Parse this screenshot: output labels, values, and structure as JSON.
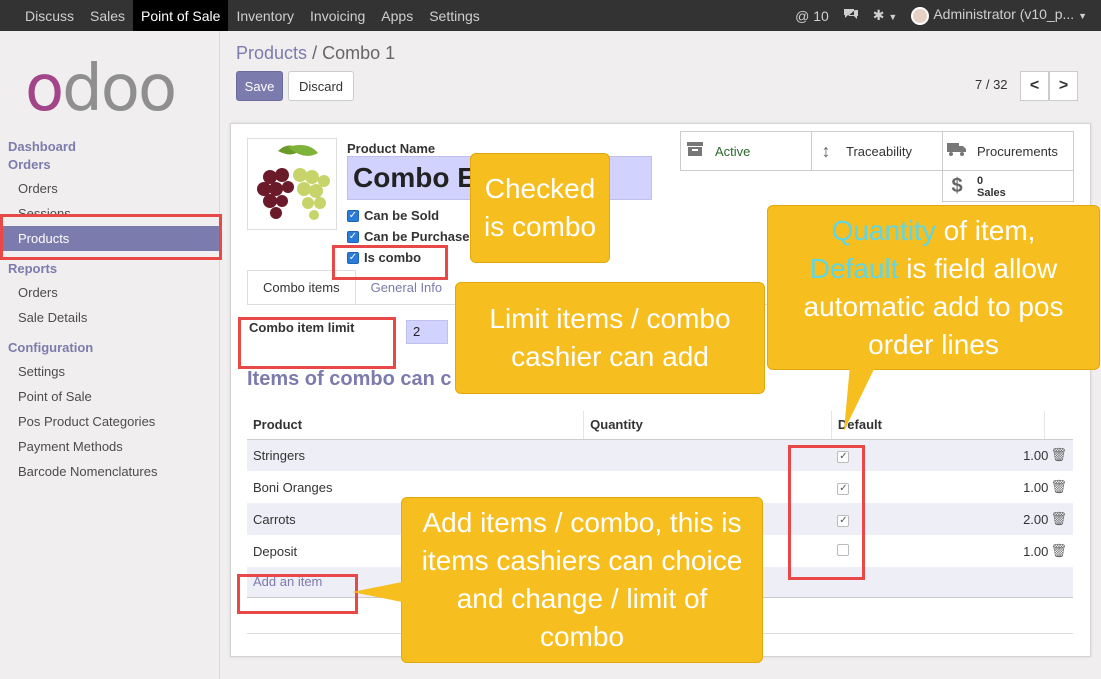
{
  "topbar": {
    "menu": [
      "Discuss",
      "Sales",
      "Point of Sale",
      "Inventory",
      "Invoicing",
      "Apps",
      "Settings"
    ],
    "active_index": 2,
    "notifications": "@ 10",
    "user": "Administrator (v10_p..."
  },
  "sidebar": {
    "logo": {
      "o1": "o",
      "rest": "doo"
    },
    "dashboard": "Dashboard",
    "orders_head": "Orders",
    "orders_items": [
      "Orders",
      "Sessions",
      "Products"
    ],
    "reports_head": "Reports",
    "reports_items": [
      "Orders",
      "Sale Details"
    ],
    "config_head": "Configuration",
    "config_items": [
      "Settings",
      "Point of Sale",
      "Pos Product Categories",
      "Payment Methods",
      "Barcode Nomenclatures"
    ]
  },
  "breadcrumb": {
    "parent": "Products",
    "separator": "/",
    "current": "Combo 1"
  },
  "buttons": {
    "save": "Save",
    "discard": "Discard"
  },
  "pager": {
    "text": "7 / 32",
    "prev": "<",
    "next": ">"
  },
  "product": {
    "name_label": "Product Name",
    "name_value": "Combo E",
    "checkboxes": [
      {
        "label": "Can be Sold",
        "checked": true
      },
      {
        "label": "Can be Purchase",
        "checked": true
      },
      {
        "label": "Is combo",
        "checked": true
      }
    ]
  },
  "stat_buttons": {
    "active": "Active",
    "traceability": "Traceability",
    "procurements": "Procurements",
    "sales_count": "0",
    "sales_label": "Sales"
  },
  "tabs": [
    "Combo items",
    "General Info"
  ],
  "combo_limit": {
    "label": "Combo item limit",
    "value": "2"
  },
  "section_title": "Items of combo can c",
  "table": {
    "headers": [
      "Product",
      "Quantity",
      "Default"
    ],
    "rows": [
      {
        "product": "Stringers",
        "qty": "1.00",
        "default": true
      },
      {
        "product": "Boni Oranges",
        "qty": "1.00",
        "default": true
      },
      {
        "product": "Carrots",
        "qty": "2.00",
        "default": true
      },
      {
        "product": "Deposit",
        "qty": "1.00",
        "default": false
      }
    ],
    "add_item": "Add an item"
  },
  "annotations": {
    "checked": [
      "Checked",
      "is combo"
    ],
    "limit": [
      "Limit items / combo",
      "cashier can add"
    ],
    "quantity": {
      "w1": "Quantity",
      "t1": " of item,",
      "w2": "Default",
      "t2": " is field allow",
      "t3": "automatic add to pos",
      "t4": "order lines"
    },
    "add": [
      "Add items / combo, this is",
      "items cashiers can choice",
      "and change / limit of",
      "combo"
    ]
  },
  "colors": {
    "accent": "#7c7bad",
    "callout": "#f6be1e",
    "redbox": "#e84848",
    "highlight": "#5fd6e6"
  }
}
